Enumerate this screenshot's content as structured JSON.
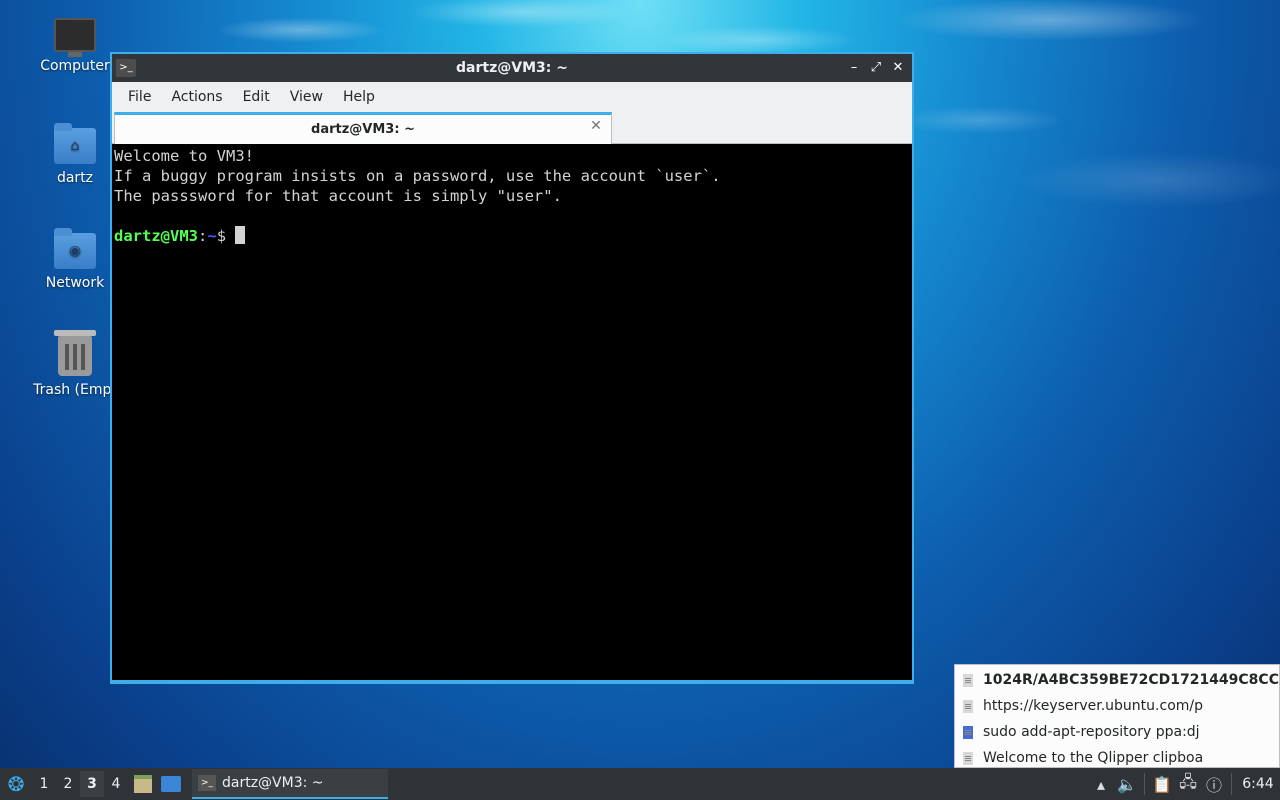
{
  "desktop": {
    "icons": [
      {
        "label": "Computer",
        "icon": "computer-icon"
      },
      {
        "label": "dartz",
        "icon": "home-folder-icon"
      },
      {
        "label": "Network",
        "icon": "network-folder-icon"
      },
      {
        "label": "Trash (Empt",
        "icon": "trash-icon"
      }
    ]
  },
  "window": {
    "title": "dartz@VM3: ~",
    "controls": {
      "minimize": "–",
      "maximize": "⤢",
      "close": "✕"
    },
    "menu": [
      "File",
      "Actions",
      "Edit",
      "View",
      "Help"
    ],
    "tab": {
      "label": "dartz@VM3: ~",
      "close": "✕"
    }
  },
  "terminal": {
    "lines": [
      "Welcome to VM3!",
      "If a buggy program insists on a password, use the account `user`.",
      "The passsword for that account is simply \"user\"."
    ],
    "prompt_user": "dartz@VM3",
    "prompt_sep": ":",
    "prompt_path": "~",
    "prompt_symbol": "$ "
  },
  "clipboard": {
    "items": [
      "1024R/A4BC359BE72CD1721449C8CC",
      "https://keyserver.ubuntu.com/p",
      "sudo add-apt-repository ppa:dj",
      "Welcome to the Qlipper clipboa"
    ]
  },
  "taskbar": {
    "desktops": [
      "1",
      "2",
      "3",
      "4"
    ],
    "active_desktop": "3",
    "task_label": "dartz@VM3: ~",
    "clock": "6:44"
  },
  "colors": {
    "accent": "#3daee9",
    "prompt_user": "#54ff54",
    "prompt_path": "#5454ff",
    "panel": "#2f3337"
  }
}
